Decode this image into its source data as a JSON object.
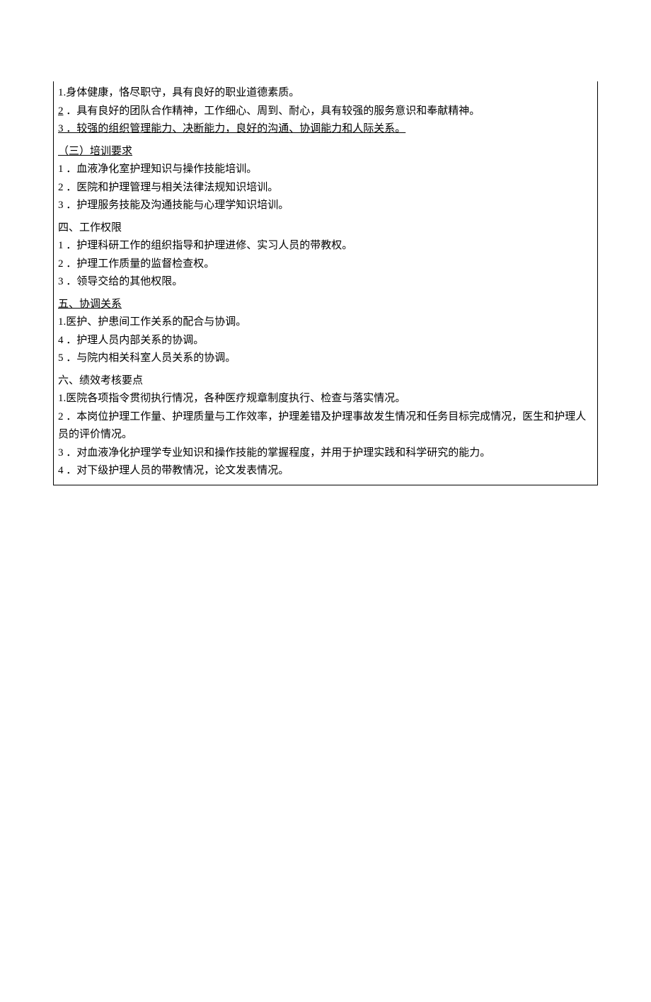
{
  "lines": [
    {
      "num": "1.",
      "numStyle": "plain",
      "text": "身体健康，恪尽职守，具有良好的职业道德素质。",
      "underline": false,
      "gap": false
    },
    {
      "num": "2",
      "numStyle": "underline",
      "text": " ．具有良好的团队合作精神，工作细心、周到、耐心，具有较强的服务意识和奉献精神。",
      "underline": false,
      "gap": false
    },
    {
      "num": "3",
      "numStyle": "underline",
      "text": " ．较强的组织管理能力、决断能力，良好的沟通、协调能力和人际关系。",
      "underline": true,
      "gap": false
    },
    {
      "num": "",
      "numStyle": "plain",
      "text": "（三）培训要求",
      "underline": true,
      "gap": true
    },
    {
      "num": "1",
      "numStyle": "plain",
      "text": " ．血液净化室护理知识与操作技能培训。",
      "underline": false,
      "gap": false
    },
    {
      "num": "2",
      "numStyle": "plain",
      "text": " ．医院和护理管理与相关法律法规知识培训。",
      "underline": false,
      "gap": false
    },
    {
      "num": "3",
      "numStyle": "plain",
      "text": " ．护理服务技能及沟通技能与心理学知识培训。",
      "underline": false,
      "gap": false
    },
    {
      "num": "",
      "numStyle": "plain",
      "text": "四、工作权限",
      "underline": false,
      "gap": true
    },
    {
      "num": "1",
      "numStyle": "plain",
      "text": " ．护理科研工作的组织指导和护理进修、实习人员的带教权。",
      "underline": false,
      "gap": false
    },
    {
      "num": "2",
      "numStyle": "plain",
      "text": " ．护理工作质量的监督检查权。",
      "underline": false,
      "gap": false
    },
    {
      "num": "3",
      "numStyle": "plain",
      "text": " ．领导交给的其他权限。",
      "underline": false,
      "gap": false
    },
    {
      "num": "",
      "numStyle": "plain",
      "text": "五、协调关系",
      "underline": true,
      "gap": true
    },
    {
      "num": "1.",
      "numStyle": "plain",
      "text": "医护、护患间工作关系的配合与协调。",
      "underline": false,
      "gap": false
    },
    {
      "num": "4",
      "numStyle": "plain",
      "text": " ．护理人员内部关系的协调。",
      "underline": false,
      "gap": false
    },
    {
      "num": "5",
      "numStyle": "plain",
      "text": " ．与院内相关科室人员关系的协调。",
      "underline": false,
      "gap": false
    },
    {
      "num": "",
      "numStyle": "plain",
      "text": "六、绩效考核要点",
      "underline": false,
      "gap": true
    },
    {
      "num": "1.",
      "numStyle": "plain",
      "text": "医院各项指令贯彻执行情况，各种医疗规章制度执行、检查与落实情况。",
      "underline": false,
      "gap": false
    },
    {
      "num": "2",
      "numStyle": "plain",
      "text": " ．本岗位护理工作量、护理质量与工作效率，护理差错及护理事故发生情况和任务目标完成情况，医生和护理人员的评价情况。",
      "underline": false,
      "gap": false
    },
    {
      "num": "3",
      "numStyle": "plain",
      "text": " ．对血液净化护理学专业知识和操作技能的掌握程度，并用于护理实践和科学研究的能力。",
      "underline": false,
      "gap": false
    },
    {
      "num": "4",
      "numStyle": "plain",
      "text": " ．对下级护理人员的带教情况，论文发表情况。",
      "underline": false,
      "gap": false
    }
  ]
}
